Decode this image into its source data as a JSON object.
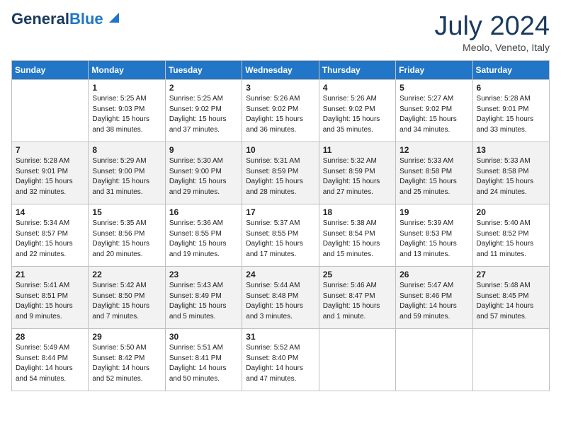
{
  "logo": {
    "line1": "General",
    "line2": "Blue"
  },
  "title": "July 2024",
  "subtitle": "Meolo, Veneto, Italy",
  "weekdays": [
    "Sunday",
    "Monday",
    "Tuesday",
    "Wednesday",
    "Thursday",
    "Friday",
    "Saturday"
  ],
  "weeks": [
    [
      {
        "day": "",
        "info": ""
      },
      {
        "day": "1",
        "info": "Sunrise: 5:25 AM\nSunset: 9:03 PM\nDaylight: 15 hours\nand 38 minutes."
      },
      {
        "day": "2",
        "info": "Sunrise: 5:25 AM\nSunset: 9:02 PM\nDaylight: 15 hours\nand 37 minutes."
      },
      {
        "day": "3",
        "info": "Sunrise: 5:26 AM\nSunset: 9:02 PM\nDaylight: 15 hours\nand 36 minutes."
      },
      {
        "day": "4",
        "info": "Sunrise: 5:26 AM\nSunset: 9:02 PM\nDaylight: 15 hours\nand 35 minutes."
      },
      {
        "day": "5",
        "info": "Sunrise: 5:27 AM\nSunset: 9:02 PM\nDaylight: 15 hours\nand 34 minutes."
      },
      {
        "day": "6",
        "info": "Sunrise: 5:28 AM\nSunset: 9:01 PM\nDaylight: 15 hours\nand 33 minutes."
      }
    ],
    [
      {
        "day": "7",
        "info": "Sunrise: 5:28 AM\nSunset: 9:01 PM\nDaylight: 15 hours\nand 32 minutes."
      },
      {
        "day": "8",
        "info": "Sunrise: 5:29 AM\nSunset: 9:00 PM\nDaylight: 15 hours\nand 31 minutes."
      },
      {
        "day": "9",
        "info": "Sunrise: 5:30 AM\nSunset: 9:00 PM\nDaylight: 15 hours\nand 29 minutes."
      },
      {
        "day": "10",
        "info": "Sunrise: 5:31 AM\nSunset: 8:59 PM\nDaylight: 15 hours\nand 28 minutes."
      },
      {
        "day": "11",
        "info": "Sunrise: 5:32 AM\nSunset: 8:59 PM\nDaylight: 15 hours\nand 27 minutes."
      },
      {
        "day": "12",
        "info": "Sunrise: 5:33 AM\nSunset: 8:58 PM\nDaylight: 15 hours\nand 25 minutes."
      },
      {
        "day": "13",
        "info": "Sunrise: 5:33 AM\nSunset: 8:58 PM\nDaylight: 15 hours\nand 24 minutes."
      }
    ],
    [
      {
        "day": "14",
        "info": "Sunrise: 5:34 AM\nSunset: 8:57 PM\nDaylight: 15 hours\nand 22 minutes."
      },
      {
        "day": "15",
        "info": "Sunrise: 5:35 AM\nSunset: 8:56 PM\nDaylight: 15 hours\nand 20 minutes."
      },
      {
        "day": "16",
        "info": "Sunrise: 5:36 AM\nSunset: 8:55 PM\nDaylight: 15 hours\nand 19 minutes."
      },
      {
        "day": "17",
        "info": "Sunrise: 5:37 AM\nSunset: 8:55 PM\nDaylight: 15 hours\nand 17 minutes."
      },
      {
        "day": "18",
        "info": "Sunrise: 5:38 AM\nSunset: 8:54 PM\nDaylight: 15 hours\nand 15 minutes."
      },
      {
        "day": "19",
        "info": "Sunrise: 5:39 AM\nSunset: 8:53 PM\nDaylight: 15 hours\nand 13 minutes."
      },
      {
        "day": "20",
        "info": "Sunrise: 5:40 AM\nSunset: 8:52 PM\nDaylight: 15 hours\nand 11 minutes."
      }
    ],
    [
      {
        "day": "21",
        "info": "Sunrise: 5:41 AM\nSunset: 8:51 PM\nDaylight: 15 hours\nand 9 minutes."
      },
      {
        "day": "22",
        "info": "Sunrise: 5:42 AM\nSunset: 8:50 PM\nDaylight: 15 hours\nand 7 minutes."
      },
      {
        "day": "23",
        "info": "Sunrise: 5:43 AM\nSunset: 8:49 PM\nDaylight: 15 hours\nand 5 minutes."
      },
      {
        "day": "24",
        "info": "Sunrise: 5:44 AM\nSunset: 8:48 PM\nDaylight: 15 hours\nand 3 minutes."
      },
      {
        "day": "25",
        "info": "Sunrise: 5:46 AM\nSunset: 8:47 PM\nDaylight: 15 hours\nand 1 minute."
      },
      {
        "day": "26",
        "info": "Sunrise: 5:47 AM\nSunset: 8:46 PM\nDaylight: 14 hours\nand 59 minutes."
      },
      {
        "day": "27",
        "info": "Sunrise: 5:48 AM\nSunset: 8:45 PM\nDaylight: 14 hours\nand 57 minutes."
      }
    ],
    [
      {
        "day": "28",
        "info": "Sunrise: 5:49 AM\nSunset: 8:44 PM\nDaylight: 14 hours\nand 54 minutes."
      },
      {
        "day": "29",
        "info": "Sunrise: 5:50 AM\nSunset: 8:42 PM\nDaylight: 14 hours\nand 52 minutes."
      },
      {
        "day": "30",
        "info": "Sunrise: 5:51 AM\nSunset: 8:41 PM\nDaylight: 14 hours\nand 50 minutes."
      },
      {
        "day": "31",
        "info": "Sunrise: 5:52 AM\nSunset: 8:40 PM\nDaylight: 14 hours\nand 47 minutes."
      },
      {
        "day": "",
        "info": ""
      },
      {
        "day": "",
        "info": ""
      },
      {
        "day": "",
        "info": ""
      }
    ]
  ]
}
